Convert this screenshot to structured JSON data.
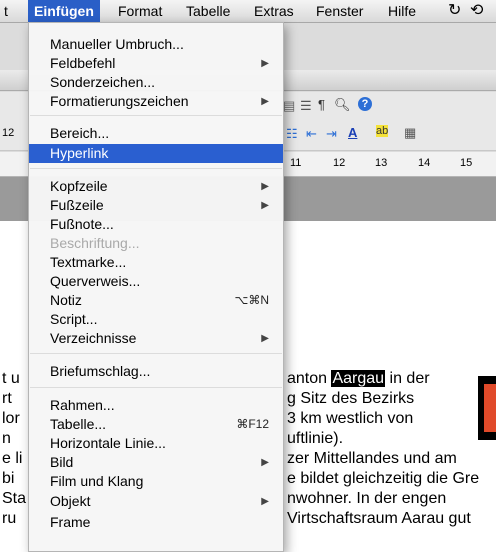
{
  "menubar": {
    "items": [
      "t",
      "Einfügen",
      "Format",
      "Tabelle",
      "Extras",
      "Fenster",
      "Hilfe"
    ]
  },
  "toolbar": {
    "font_size": "12"
  },
  "ruler": {
    "numbers": [
      "11",
      "12",
      "13",
      "14",
      "15"
    ]
  },
  "menu": {
    "items": [
      {
        "label": "Manueller Umbruch...",
        "submenu": false,
        "shortcut": "",
        "disabled": false
      },
      {
        "label": "Feldbefehl",
        "submenu": true,
        "shortcut": "",
        "disabled": false
      },
      {
        "label": "Sonderzeichen...",
        "submenu": false,
        "shortcut": "",
        "disabled": false
      },
      {
        "label": "Formatierungszeichen",
        "submenu": true,
        "shortcut": "",
        "disabled": false
      },
      {
        "label": "Bereich...",
        "submenu": false,
        "shortcut": "",
        "disabled": false
      },
      {
        "label": "Hyperlink",
        "submenu": false,
        "shortcut": "",
        "disabled": false,
        "highlighted": true
      },
      {
        "label": "Kopfzeile",
        "submenu": true,
        "shortcut": "",
        "disabled": false
      },
      {
        "label": "Fußzeile",
        "submenu": true,
        "shortcut": "",
        "disabled": false
      },
      {
        "label": "Fußnote...",
        "submenu": false,
        "shortcut": "",
        "disabled": false
      },
      {
        "label": "Beschriftung...",
        "submenu": false,
        "shortcut": "",
        "disabled": true
      },
      {
        "label": "Textmarke...",
        "submenu": false,
        "shortcut": "",
        "disabled": false
      },
      {
        "label": "Querverweis...",
        "submenu": false,
        "shortcut": "",
        "disabled": false
      },
      {
        "label": "Notiz",
        "submenu": false,
        "shortcut": "⌥⌘N",
        "disabled": false
      },
      {
        "label": "Script...",
        "submenu": false,
        "shortcut": "",
        "disabled": false
      },
      {
        "label": "Verzeichnisse",
        "submenu": true,
        "shortcut": "",
        "disabled": false
      },
      {
        "label": "Briefumschlag...",
        "submenu": false,
        "shortcut": "",
        "disabled": false
      },
      {
        "label": "Rahmen...",
        "submenu": false,
        "shortcut": "",
        "disabled": false
      },
      {
        "label": "Tabelle...",
        "submenu": false,
        "shortcut": "⌘F12",
        "disabled": false
      },
      {
        "label": "Horizontale Linie...",
        "submenu": false,
        "shortcut": "",
        "disabled": false
      },
      {
        "label": "Bild",
        "submenu": true,
        "shortcut": "",
        "disabled": false
      },
      {
        "label": "Film und Klang",
        "submenu": false,
        "shortcut": "",
        "disabled": false
      },
      {
        "label": "Objekt",
        "submenu": true,
        "shortcut": "",
        "disabled": false
      },
      {
        "label": "Frame",
        "submenu": false,
        "shortcut": "",
        "disabled": false
      }
    ]
  },
  "document": {
    "lines": [
      {
        "left": "t u",
        "right_pre": "anton ",
        "highlight": "Aargau",
        "right_post": " in der"
      },
      {
        "left": "rt",
        "right_pre": "g Sitz des Bezirks",
        "highlight": "",
        "right_post": ""
      },
      {
        "left": "lor",
        "right_pre": "3 km westlich von",
        "highlight": "",
        "right_post": ""
      },
      {
        "left": " n",
        "right_pre": "uftlinie).",
        "highlight": "",
        "right_post": ""
      },
      {
        "left": "e li",
        "right_pre": "zer Mittellandes und am",
        "highlight": "",
        "right_post": ""
      },
      {
        "left": "bi",
        "right_pre": "e bildet gleichzeitig die Gre",
        "highlight": "",
        "right_post": ""
      },
      {
        "left": "Sta",
        "right_pre": "nwohner. In der engen",
        "highlight": "",
        "right_post": ""
      },
      {
        "left": "ru",
        "right_pre": "Virtschaftsraum Aarau gut",
        "highlight": "",
        "right_post": ""
      }
    ]
  }
}
